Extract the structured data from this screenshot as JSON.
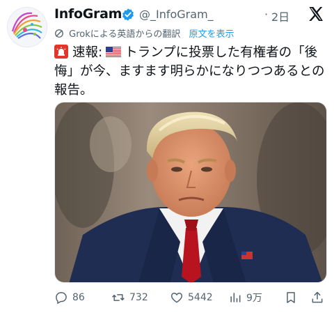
{
  "tweet": {
    "author_name": "InfoGram",
    "handle": "@_InfoGram_",
    "separator": "·",
    "time": "2日",
    "translation_note": "Grokによる英語からの翻訳",
    "show_original_label": "原文を表示",
    "text_prefix": "速報:",
    "text_body": "トランプに投票した有権者の「後悔」が今、ますます明らかになりつつあるとの報告。",
    "flag_icon": "us-flag-icon",
    "badge_icon": "siren-icon"
  },
  "actions": {
    "reply_count": "86",
    "repost_count": "732",
    "like_count": "5442",
    "views_count": "9万"
  },
  "colors": {
    "accent": "#1d9bf0",
    "muted": "#536471",
    "text": "#0f1419",
    "verified": "#1d9bf0"
  }
}
